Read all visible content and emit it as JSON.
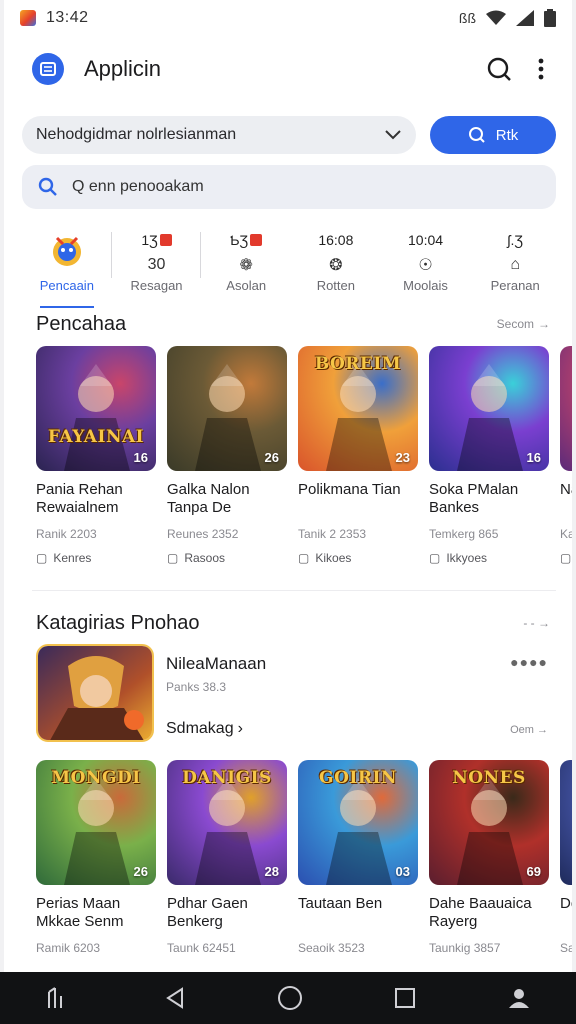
{
  "status_bar": {
    "time": "13:42",
    "right_text": "ßß"
  },
  "header": {
    "title": "Applicin"
  },
  "filter": {
    "dropdown_text": "Nehodgidmar nolrlesianman",
    "button_label": "Rtk"
  },
  "search": {
    "placeholder": "Q enn penooakam"
  },
  "categories": [
    {
      "top": "",
      "mid": "",
      "label": "Pencaain",
      "active": true
    },
    {
      "top": "1Ʒ",
      "mid": "30",
      "label": "Resagan"
    },
    {
      "top": "ƄƷ",
      "mid": "❁",
      "label": "Asolan"
    },
    {
      "top": "16:08",
      "mid": "❂",
      "label": "Rotten"
    },
    {
      "top": "10:04",
      "mid": "☉",
      "label": "Moolais"
    },
    {
      "top": "ʃ.Ʒ",
      "mid": "⌂",
      "label": "Peranan"
    }
  ],
  "section1": {
    "title": "Pencahaa",
    "more": "Secom",
    "cards": [
      {
        "name": "Pania Rehan Rewaialnem",
        "meta": "Ranik 2203",
        "sub": "Kenres",
        "badge": "16",
        "art_title": "FAYAINAI",
        "colors": [
          "#2a2350",
          "#6b3fa0",
          "#c9456a"
        ]
      },
      {
        "name": "Galka Nalon Tanpa De",
        "meta": "Reunes 2352",
        "sub": "Rasoos",
        "badge": "26",
        "art_title": "",
        "colors": [
          "#3a3a28",
          "#6b5a36",
          "#c27a3a"
        ]
      },
      {
        "name": "Polikmana Tian",
        "meta": "Tanik 2 2353",
        "sub": "Kikoes",
        "badge": "23",
        "art_title": "BOREIM",
        "colors": [
          "#d9542b",
          "#f0a03a",
          "#3a6ec9"
        ]
      },
      {
        "name": "Soka PMalan Bankes",
        "meta": "Temkerg 865",
        "sub": "Ikkyoes",
        "badge": "16",
        "art_title": "",
        "colors": [
          "#2b2f8f",
          "#7a3fd0",
          "#3ad0d9"
        ]
      },
      {
        "name": "Nar Dat",
        "meta": "Kal",
        "sub": "Pe",
        "badge": "",
        "art_title": "",
        "colors": [
          "#5a2a7a",
          "#c9456a",
          "#f0a03a"
        ]
      }
    ]
  },
  "section2": {
    "title": "Katagirias Pnohao",
    "more": "",
    "feature": {
      "title": "NileaManaan",
      "sub": "Panks 38.3",
      "link": "Sdmakag",
      "more": "Oem"
    },
    "cards": [
      {
        "name": "Perias Maan Mkkae Senm",
        "meta": "Ramik 6203",
        "badge": "26",
        "art_title": "MONGDI",
        "colors": [
          "#2f6a3a",
          "#7ab04a",
          "#c96a3a"
        ]
      },
      {
        "name": "Pdhar Gaen Benkerg",
        "meta": "Taunk 62451",
        "badge": "28",
        "art_title": "DANIGIS",
        "colors": [
          "#3a2a6a",
          "#8a4ad0",
          "#e0a02a"
        ]
      },
      {
        "name": "Tautaan Ben",
        "meta": "Seaoik 3523",
        "badge": "03",
        "art_title": "GOIRIN",
        "colors": [
          "#2b4fb0",
          "#3a9ad9",
          "#e06a3a"
        ]
      },
      {
        "name": "Dahe Baauaica Rayerg",
        "meta": "Taunkig 3857",
        "badge": "69",
        "art_title": "NONES",
        "colors": [
          "#5a1e2e",
          "#b0302a",
          "#3a2a1a"
        ]
      },
      {
        "name": "Dex Pah",
        "meta": "Sal",
        "badge": "",
        "art_title": "",
        "colors": [
          "#1e2a5a",
          "#4a5ab0",
          "#c9c9e0"
        ]
      }
    ]
  },
  "colors": {
    "accent": "#2f66e8",
    "navbar": "#111214"
  }
}
